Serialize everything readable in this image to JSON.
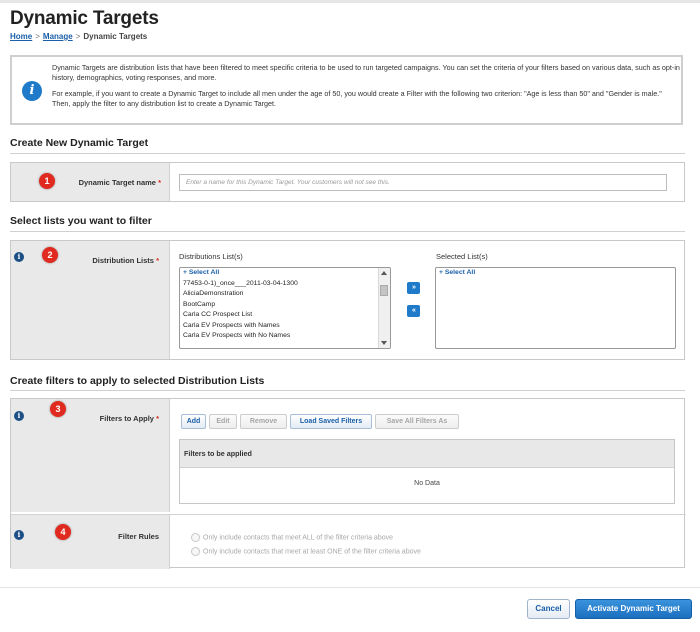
{
  "header": {
    "title": "Dynamic Targets",
    "breadcrumb": [
      "Home",
      "Manage",
      "Dynamic Targets"
    ]
  },
  "info": {
    "paragraph1": "Dynamic Targets are distribution lists that have been filtered to meet specific criteria to be used to run targeted campaigns. You can set the criteria of your filters based on various data, such as opt-in history, demographics, voting responses, and more.",
    "paragraph2": "For example, if you want to create a Dynamic Target to include all men under the age of 50, you would create a Filter with the following two criterion: \"Age is less than 50\" and \"Gender is male.\" Then, apply the filter to any distribution list to create a Dynamic Target."
  },
  "create": {
    "heading": "Create New Dynamic Target",
    "step": "1",
    "label": "Dynamic Target name",
    "required": "*",
    "placeholder": "Enter a name for this Dynamic Target. Your customers will not see this."
  },
  "lists": {
    "heading": "Select lists you want to filter",
    "step": "2",
    "label": "Distribution Lists",
    "required": "*",
    "available_title": "Distributions List(s)",
    "selected_title": "Selected List(s)",
    "available_items": [
      "+ Select All",
      "77453-0-1)_once___2011-03-04-1300",
      "AliciaDemonstration",
      "BootCamp",
      "Carla CC Prospect List",
      "Carla EV Prospects with Names",
      "Carla EV Prospects with No Names"
    ],
    "selected_items": [
      "+ Select All"
    ],
    "move_right": "»",
    "move_left": "«"
  },
  "filters": {
    "heading": "Create filters to apply to selected Distribution Lists",
    "step": "3",
    "label": "Filters to Apply",
    "required": "*",
    "buttons": {
      "add": "Add",
      "edit": "Edit",
      "remove": "Remove",
      "load": "Load Saved Filters",
      "save": "Save All Filters As"
    },
    "grid_header": "Filters to be applied",
    "no_data": "No Data"
  },
  "rules": {
    "step": "4",
    "label": "Filter Rules",
    "option_all": "Only include contacts that meet ALL of the filter criteria above",
    "option_one": "Only include contacts that meet at least ONE of the filter criteria above"
  },
  "footer": {
    "cancel": "Cancel",
    "activate": "Activate Dynamic Target"
  }
}
